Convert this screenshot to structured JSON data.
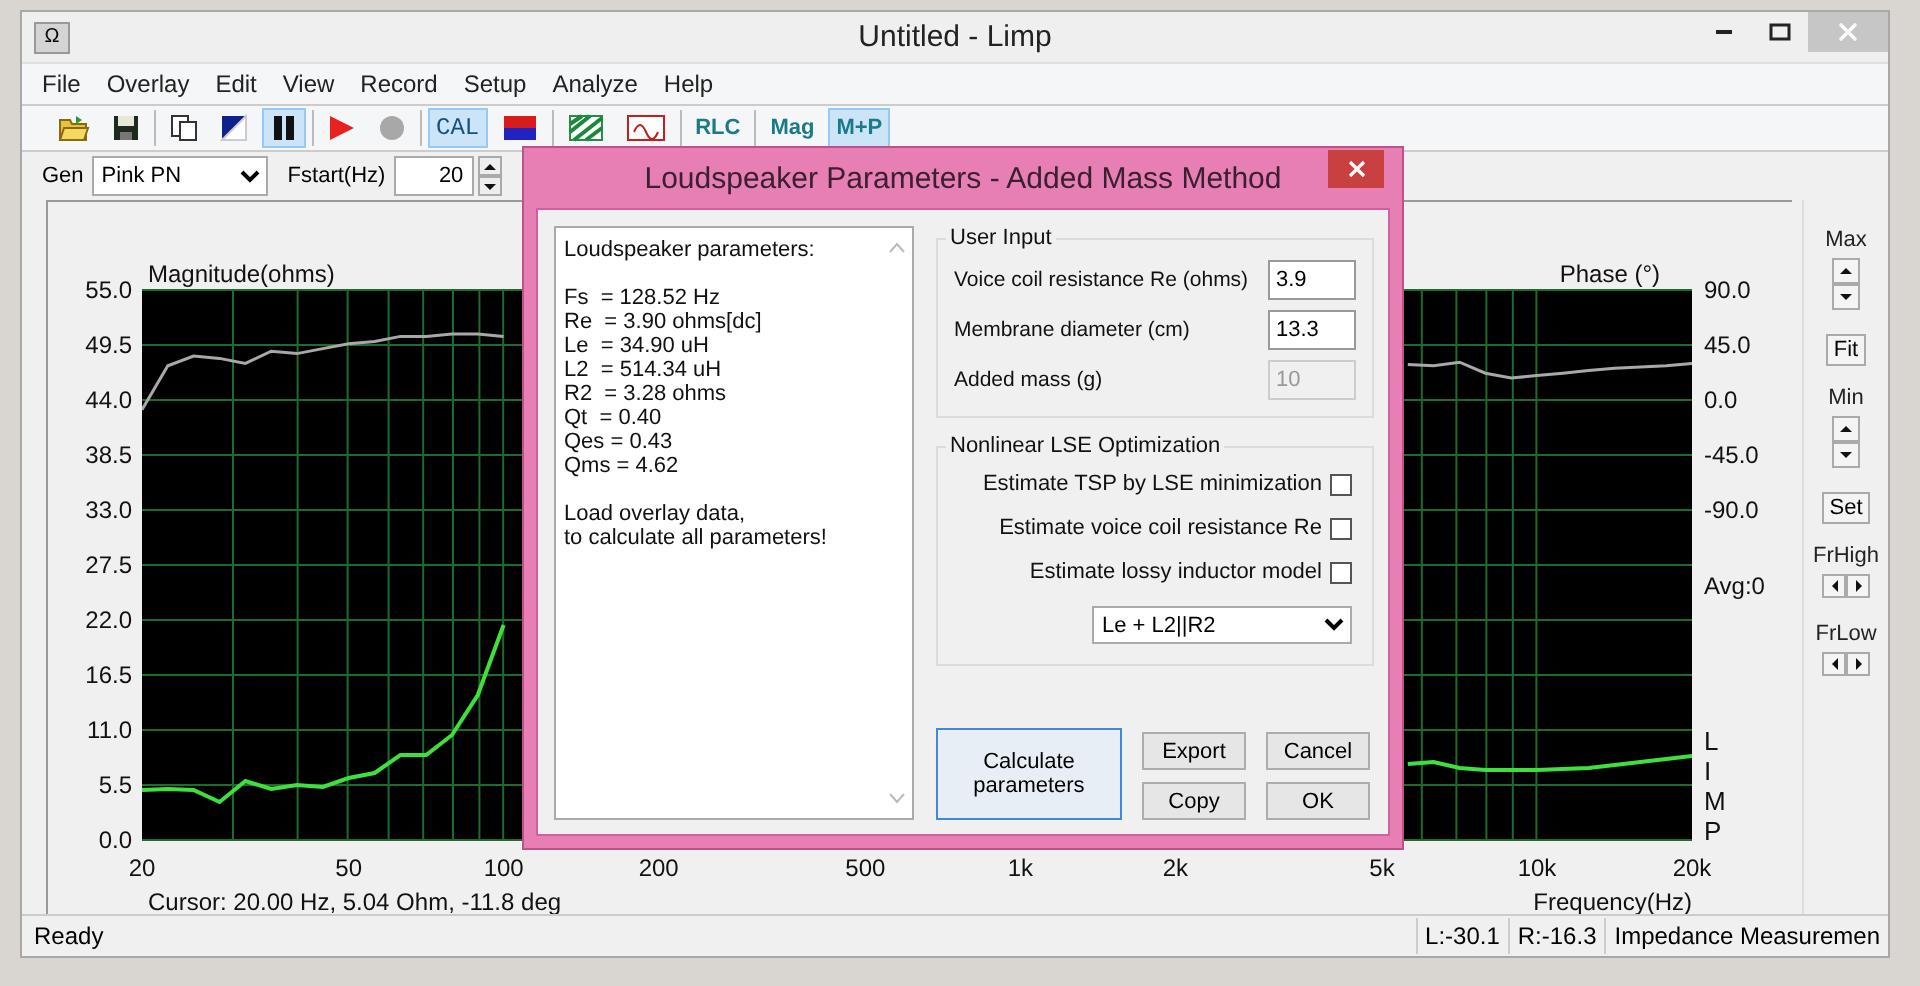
{
  "window": {
    "app_icon": "Ω",
    "title": "Untitled - Limp"
  },
  "menu": [
    "File",
    "Overlay",
    "Edit",
    "View",
    "Record",
    "Setup",
    "Analyze",
    "Help"
  ],
  "toolbar": [
    {
      "kind": "folder",
      "pressed": false
    },
    {
      "kind": "floppy",
      "pressed": false
    },
    {
      "kind": "separator"
    },
    {
      "kind": "document",
      "pressed": false
    },
    {
      "kind": "triangle",
      "pressed": false
    },
    {
      "kind": "pause",
      "pressed": true
    },
    {
      "kind": "separator"
    },
    {
      "kind": "play",
      "pressed": false
    },
    {
      "kind": "record",
      "pressed": false
    },
    {
      "kind": "separator"
    },
    {
      "kind": "text",
      "label": "CAL",
      "pressed": true
    },
    {
      "kind": "colorbox",
      "pressed": false
    },
    {
      "kind": "separator"
    },
    {
      "kind": "stripes",
      "pressed": false
    },
    {
      "kind": "overlay",
      "pressed": false
    },
    {
      "kind": "separator"
    },
    {
      "kind": "text",
      "label": "RLC",
      "pressed": false
    },
    {
      "kind": "separator"
    },
    {
      "kind": "text",
      "label": "Mag",
      "pressed": false
    },
    {
      "kind": "text",
      "label": "M+P",
      "pressed": true
    }
  ],
  "generator": {
    "label": "Gen",
    "value": "Pink PN"
  },
  "fstart": {
    "label": "Fstart(Hz)",
    "value": "20"
  },
  "chart": {
    "legend": "LIMP",
    "avg": "Avg:0",
    "cursor": "Cursor: 20.00 Hz, 5.04 Ohm, -11.8 deg",
    "chart_data": {
      "type": "line",
      "ylabel": "Magnitude(ohms)",
      "y2label": "Phase (°)",
      "xlabel": "Frequency(Hz)",
      "categories": [
        "20",
        null,
        null,
        null,
        null,
        null,
        null,
        null,
        "50",
        null,
        null,
        null,
        null,
        null,
        "100",
        null,
        null,
        null,
        null,
        null,
        "200",
        null,
        null,
        null,
        null,
        null,
        null,
        null,
        "500",
        null,
        null,
        null,
        null,
        null,
        "1k",
        null,
        null,
        null,
        null,
        null,
        "2k",
        null,
        null,
        null,
        null,
        null,
        null,
        null,
        "5k",
        null,
        null,
        null,
        null,
        null,
        "10k",
        null,
        null,
        null,
        null,
        null,
        "20k"
      ],
      "series": [
        {
          "color": "#3ee03e",
          "values": [
            5.0,
            5.1,
            5.0,
            3.8,
            5.9,
            5.1,
            5.5,
            5.3,
            6.2,
            6.7,
            8.5,
            8.5,
            10.5,
            14.5,
            21.5,
            null,
            null,
            null,
            null,
            null,
            null,
            null,
            null,
            null,
            null,
            null,
            null,
            null,
            null,
            null,
            null,
            null,
            null,
            null,
            null,
            null,
            null,
            null,
            null,
            null,
            null,
            null,
            null,
            null,
            null,
            null,
            null,
            null,
            null,
            7.6,
            7.8,
            7.2,
            7.0,
            7.0,
            7.0,
            7.1,
            7.2,
            7.5,
            7.8,
            8.1,
            8.4
          ]
        },
        {
          "color": "#a8a8a8",
          "axis": "y2",
          "values": [
            -8,
            28,
            36,
            34,
            30,
            40,
            38,
            42,
            46,
            48,
            52,
            52,
            54,
            54,
            52,
            null,
            null,
            null,
            null,
            null,
            null,
            null,
            null,
            null,
            null,
            null,
            null,
            null,
            null,
            null,
            null,
            null,
            null,
            null,
            null,
            null,
            null,
            null,
            null,
            null,
            null,
            null,
            null,
            null,
            null,
            null,
            null,
            null,
            null,
            29,
            28,
            31,
            22,
            18,
            20,
            22,
            24,
            26,
            27,
            28,
            30
          ]
        }
      ],
      "grid": true,
      "ylim": [
        0,
        55
      ],
      "y2lim": [
        -360,
        90
      ],
      "yticks": [
        {
          "value": 0,
          "label": "0.0"
        },
        {
          "value": 5.5,
          "label": "5.5"
        },
        {
          "value": 11,
          "label": "11.0"
        },
        {
          "value": 16.5,
          "label": "16.5"
        },
        {
          "value": 22,
          "label": "22.0"
        },
        {
          "value": 27.5,
          "label": "27.5"
        },
        {
          "value": 33,
          "label": "33.0"
        },
        {
          "value": 38.5,
          "label": "38.5"
        },
        {
          "value": 44,
          "label": "44.0"
        },
        {
          "value": 49.5,
          "label": "49.5"
        },
        {
          "value": 55,
          "label": "55.0"
        }
      ],
      "y2ticks": [
        {
          "value": 90,
          "label": "90.0"
        },
        {
          "value": 45,
          "label": "45.0"
        },
        {
          "value": 0,
          "label": "0.0"
        },
        {
          "value": -45,
          "label": "-45.0"
        },
        {
          "value": -90,
          "label": "-90.0"
        }
      ]
    }
  },
  "side_panel": {
    "max": "Max",
    "fit": "Fit",
    "min": "Min",
    "set": "Set",
    "frhigh": "FrHigh",
    "frlow": "FrLow"
  },
  "status_bar": {
    "message": "Ready",
    "fields": [
      "L:-30.1",
      "R:-16.3",
      "Impedance Measuremen"
    ]
  },
  "dialog": {
    "title": "Loudspeaker Parameters - Added Mass Method",
    "results": {
      "heading": "Loudspeaker parameters:",
      "params": [
        "Fs  = 128.52 Hz",
        "Re  = 3.90 ohms[dc]",
        "Le  = 34.90 uH",
        "L2  = 514.34 uH",
        "R2  = 3.28 ohms",
        "Qt  = 0.40",
        "Qes = 0.43",
        "Qms = 4.62"
      ],
      "note": [
        "Load overlay data,",
        "to calculate all parameters!"
      ]
    },
    "user_input": {
      "title": "User Input",
      "fields": [
        {
          "label": "Voice coil resistance Re (ohms)",
          "value": "3.9",
          "disabled": false
        },
        {
          "label": "Membrane diameter (cm)",
          "value": "13.3",
          "disabled": false
        },
        {
          "label": "Added mass (g)",
          "value": "10",
          "disabled": true
        }
      ]
    },
    "optimization": {
      "title": "Nonlinear LSE Optimization",
      "options": [
        {
          "label": "Estimate TSP by LSE minimization",
          "checked": false
        },
        {
          "label": "Estimate voice coil resistance Re",
          "checked": false
        },
        {
          "label": "Estimate lossy inductor model",
          "checked": false
        }
      ],
      "model": "Le + L2||R2"
    },
    "buttons": [
      {
        "label": "Calculate parameters",
        "default": true
      },
      {
        "label": "Export",
        "default": false
      },
      {
        "label": "Cancel",
        "default": false
      },
      {
        "label": "Copy",
        "default": false
      },
      {
        "label": "OK",
        "default": false
      }
    ]
  }
}
